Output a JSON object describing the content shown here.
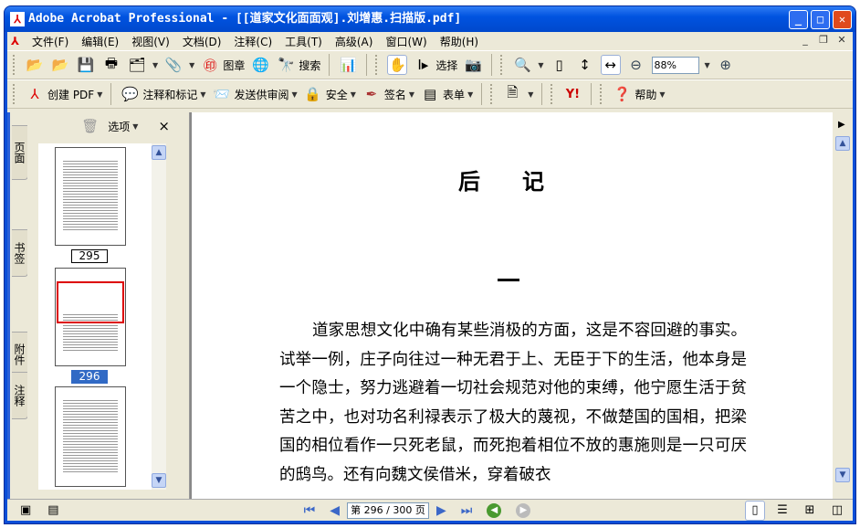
{
  "window": {
    "title": "Adobe Acrobat Professional - [[道家文化面面观].刘增惠.扫描版.pdf]"
  },
  "menu": [
    "文件(F)",
    "编辑(E)",
    "视图(V)",
    "文档(D)",
    "注释(C)",
    "工具(T)",
    "高级(A)",
    "窗口(W)",
    "帮助(H)"
  ],
  "toolbar1": {
    "stamp": "图章",
    "search": "搜索",
    "select": "选择",
    "zoom": "88%"
  },
  "toolbar2": {
    "create_pdf": "创建 PDF",
    "comment": "注释和标记",
    "review": "发送供审阅",
    "security": "安全",
    "sign": "签名",
    "forms": "表单",
    "help": "帮助"
  },
  "sidebar": {
    "tabs": [
      "页面",
      "书签",
      "附件",
      "注释"
    ],
    "options": "选项",
    "close": "×",
    "pages": [
      "295",
      "296"
    ]
  },
  "document": {
    "heading": "后记",
    "section": "一",
    "text": "道家思想文化中确有某些消极的方面，这是不容回避的事实。试举一例，庄子向往过一种无君于上、无臣于下的生活，他本身是一个隐士，努力逃避着一切社会规范对他的束缚，他宁愿生活于贫苦之中，也对功名利禄表示了极大的蔑视，不做楚国的国相，把梁国的相位看作一只死老鼠，而死抱着相位不放的惠施则是一只可厌的鸱鸟。还有向魏文侯借米，穿着破衣"
  },
  "status": {
    "page": "第 296 / 300 页"
  }
}
